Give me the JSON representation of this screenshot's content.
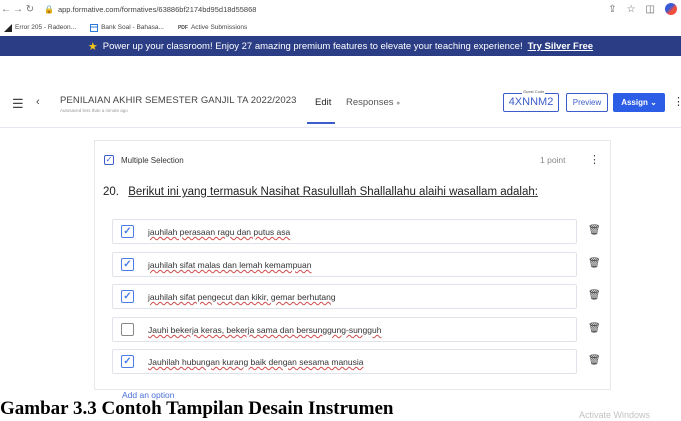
{
  "browser": {
    "url": "app.formative.com/formatives/63886bf2174bd95d18d55868",
    "bookmarks": [
      {
        "label": "Error 205 - Radeon..."
      },
      {
        "label": "Bank Soal - Bahasa..."
      },
      {
        "label": "Active Submissions"
      }
    ]
  },
  "promo": {
    "text": "Power up your classroom! Enjoy 27 amazing premium features to elevate your teaching experience!",
    "link": "Try Silver Free"
  },
  "header": {
    "title": "PENILAIAN AKHIR SEMESTER GANJIL TA 2022/2023",
    "autosave": "Autosaved less than a minute ago",
    "tab_edit": "Edit",
    "tab_responses": "Responses",
    "tab_responses_dot": "●",
    "guest_code_label": "Guest Code",
    "guest_code": "4XNNM2",
    "preview": "Preview",
    "assign": "Assign"
  },
  "question": {
    "type": "Multiple Selection",
    "points": "1  point",
    "number": "20.",
    "text": "Berikut ini yang termasuk Nasihat Rasulullah Shallallahu alaihi wasallam adalah:",
    "options": [
      {
        "text": "jauhilah perasaan  ragu dan putus asa",
        "checked": true
      },
      {
        "text": "jauhilah sifat malas dan lemah kemampuan",
        "checked": true
      },
      {
        "text": "jauhilah sifat pengecut dan kikir, gemar  berhutang",
        "checked": true
      },
      {
        "text": "Jauhi bekerja keras, bekerja sama dan bersunggung-sungguh",
        "checked": false
      },
      {
        "text": "Jauhilah hubungan kurang baik dengan sesama manusia",
        "checked": true
      }
    ],
    "add_option": "Add an option"
  },
  "caption": "Gambar 3.3 Contoh Tampilan Desain Instrumen",
  "watermark": "Activate Windows",
  "colors": {
    "banner": "#2b3d85",
    "accent": "#3d5ccc",
    "assign_button": "#2b5de6"
  }
}
